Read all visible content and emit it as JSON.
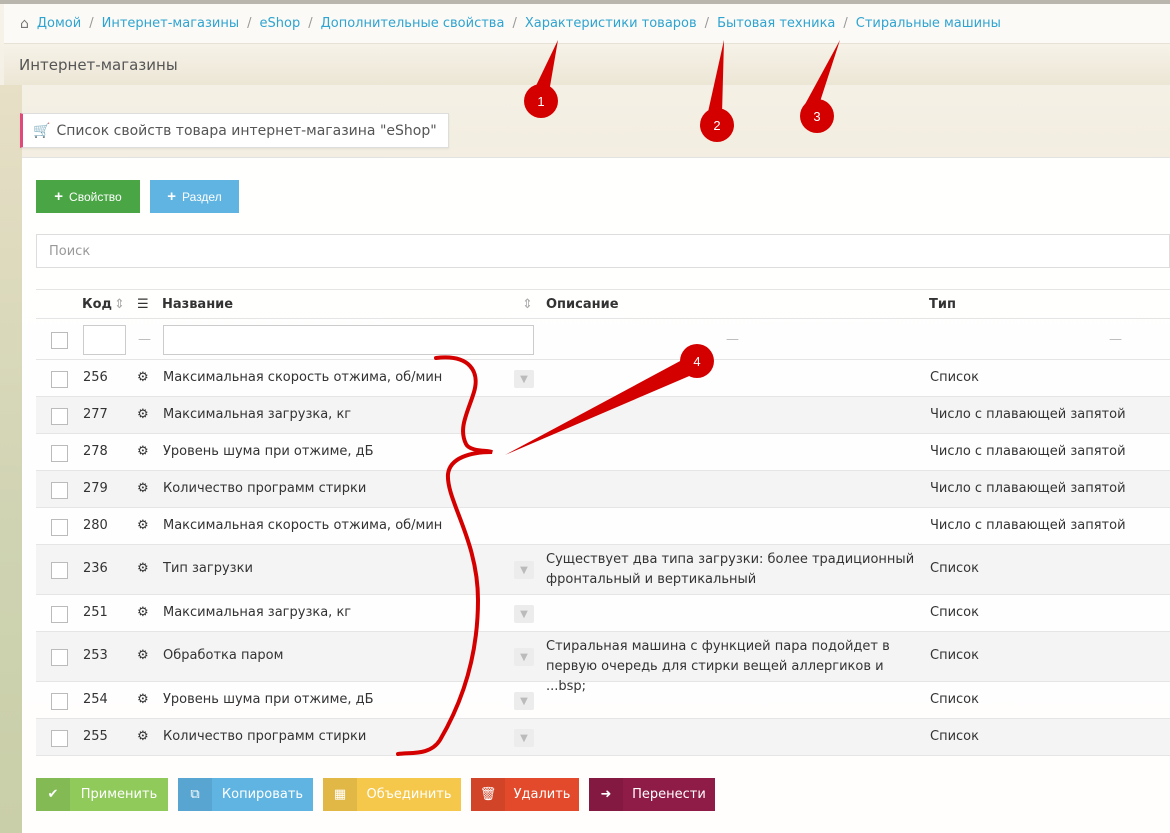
{
  "breadcrumb": {
    "items": [
      "Домой",
      "Интернет-магазины",
      "eShop",
      "Дополнительные свойства",
      "Характеристики товаров",
      "Бытовая техника",
      "Стиральные машины"
    ]
  },
  "page_title": "Интернет-магазины",
  "panel_tab": "Список свойств товара интернет-магазина \"eShop\"",
  "toolbar": {
    "add_property": "Свойство",
    "add_section": "Раздел"
  },
  "search": {
    "placeholder": "Поиск"
  },
  "table": {
    "headers": {
      "code": "Код",
      "name": "Название",
      "description": "Описание",
      "type": "Тип"
    },
    "filter_dash": "—",
    "rows": [
      {
        "code": "256",
        "name": "Максимальная скорость отжима, об/мин",
        "description": "",
        "type": "Список",
        "filter_icon": true
      },
      {
        "code": "277",
        "name": "Максимальная загрузка, кг",
        "description": "",
        "type": "Число с плавающей запятой",
        "filter_icon": false
      },
      {
        "code": "278",
        "name": "Уровень шума при отжиме, дБ",
        "description": "",
        "type": "Число с плавающей запятой",
        "filter_icon": false
      },
      {
        "code": "279",
        "name": "Количество программ стирки",
        "description": "",
        "type": "Число с плавающей запятой",
        "filter_icon": false
      },
      {
        "code": "280",
        "name": "Максимальная скорость отжима, об/мин",
        "description": "",
        "type": "Число с плавающей запятой",
        "filter_icon": false
      },
      {
        "code": "236",
        "name": "Тип загрузки",
        "description": "Существует два типа загрузки: более традиционный фронтальный и вертикальный",
        "type": "Список",
        "filter_icon": true
      },
      {
        "code": "251",
        "name": "Максимальная загрузка, кг",
        "description": "",
        "type": "Список",
        "filter_icon": true
      },
      {
        "code": "253",
        "name": "Обработка паром",
        "description": "Стиральная машина с функцией пара подойдет в первую очередь для стирки вещей аллергиков и ...bsp;",
        "type": "Список",
        "filter_icon": true
      },
      {
        "code": "254",
        "name": "Уровень шума при отжиме, дБ",
        "description": "",
        "type": "Список",
        "filter_icon": true
      },
      {
        "code": "255",
        "name": "Количество программ стирки",
        "description": "",
        "type": "Список",
        "filter_icon": true
      }
    ]
  },
  "actions": {
    "apply": "Применить",
    "copy": "Копировать",
    "merge": "Объединить",
    "delete": "Удалить",
    "move": "Перенести"
  },
  "annotations": {
    "badges": [
      "1",
      "2",
      "3",
      "4"
    ],
    "color": "#d40000"
  },
  "colors": {
    "accent_link": "#2fa4d1",
    "green": "#4aa545",
    "blue": "#5fb4e2",
    "tab_border": "#e0497a"
  }
}
